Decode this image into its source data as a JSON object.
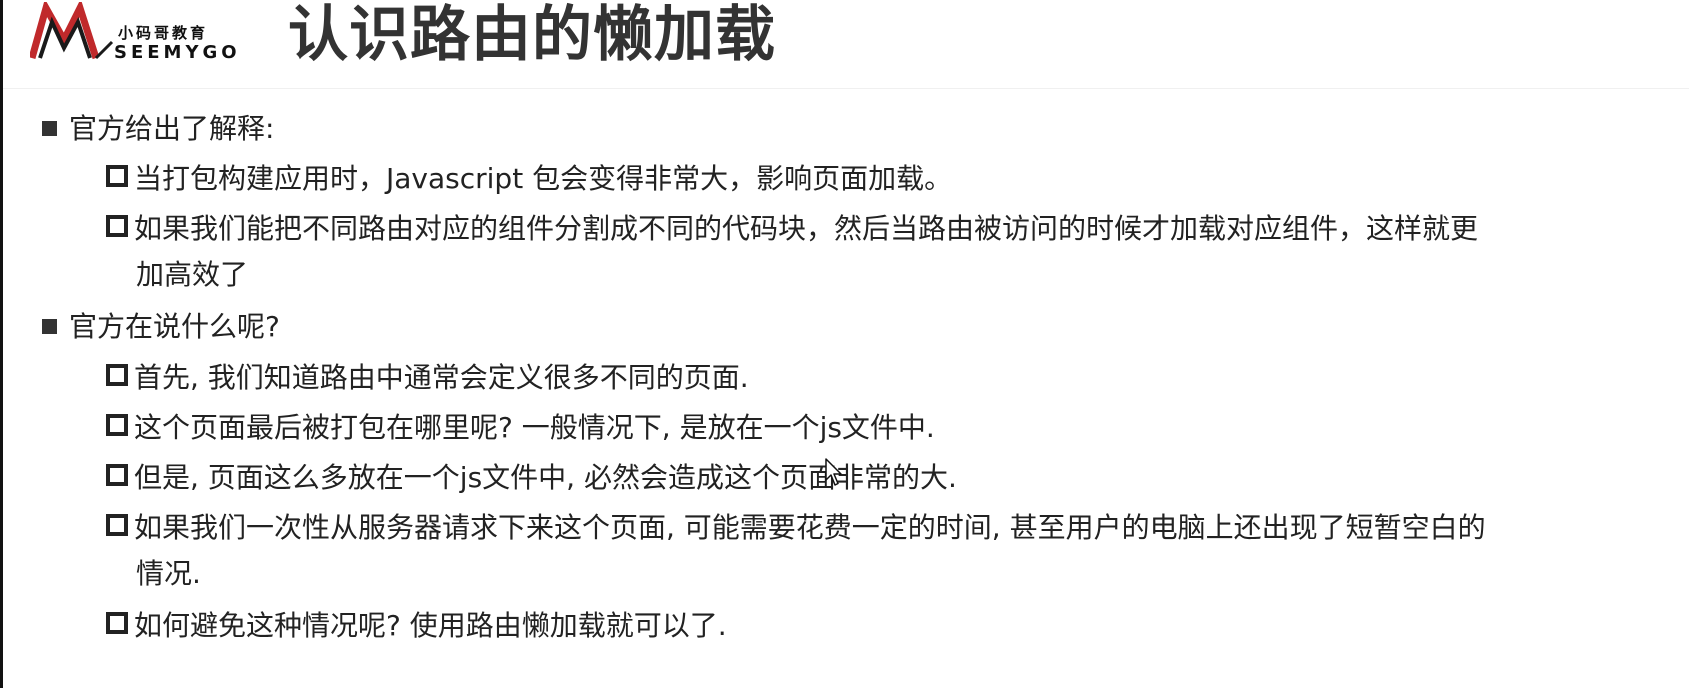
{
  "logo": {
    "cn": "小码哥教育",
    "en": "SEEMYGO"
  },
  "title": "认识路由的懒加载",
  "sections": [
    {
      "heading": "官方给出了解释:",
      "items": [
        {
          "text": "当打包构建应用时，Javascript 包会变得非常大，影响页面加载。"
        },
        {
          "text": "如果我们能把不同路由对应的组件分割成不同的代码块，然后当路由被访问的时候才加载对应组件，这样就更",
          "cont": "加高效了"
        }
      ]
    },
    {
      "heading": "官方在说什么呢?",
      "items": [
        {
          "text": "首先, 我们知道路由中通常会定义很多不同的页面."
        },
        {
          "text": "这个页面最后被打包在哪里呢? 一般情况下, 是放在一个js文件中."
        },
        {
          "text": "但是, 页面这么多放在一个js文件中, 必然会造成这个页面非常的大."
        },
        {
          "text": "如果我们一次性从服务器请求下来这个页面, 可能需要花费一定的时间, 甚至用户的电脑上还出现了短暂空白的",
          "cont": "情况."
        },
        {
          "text": "如何避免这种情况呢? 使用路由懒加载就可以了."
        }
      ]
    }
  ]
}
